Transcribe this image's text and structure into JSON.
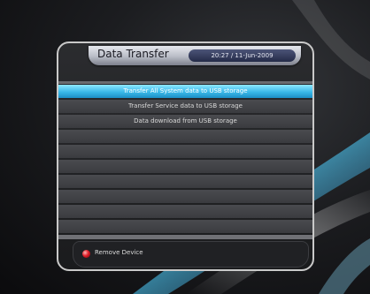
{
  "window": {
    "title": "Data Transfer",
    "datetime": "20:27 / 11-Jun-2009"
  },
  "menu": {
    "items": [
      {
        "label": "Transfer All System data to USB storage",
        "selected": true
      },
      {
        "label": "Transfer Service data to USB storage",
        "selected": false
      },
      {
        "label": "Data download from USB storage",
        "selected": false
      },
      {
        "label": "",
        "selected": false
      },
      {
        "label": "",
        "selected": false
      },
      {
        "label": "",
        "selected": false
      },
      {
        "label": "",
        "selected": false
      },
      {
        "label": "",
        "selected": false
      },
      {
        "label": "",
        "selected": false
      },
      {
        "label": "",
        "selected": false
      }
    ]
  },
  "footer": {
    "red_button": {
      "icon": "red-button-icon",
      "label": "Remove Device"
    }
  },
  "colors": {
    "selection": "#3ab9e8",
    "title_bar": "#c9ccd6",
    "time_box": "#2f375a",
    "red_key": "#e0202a"
  }
}
